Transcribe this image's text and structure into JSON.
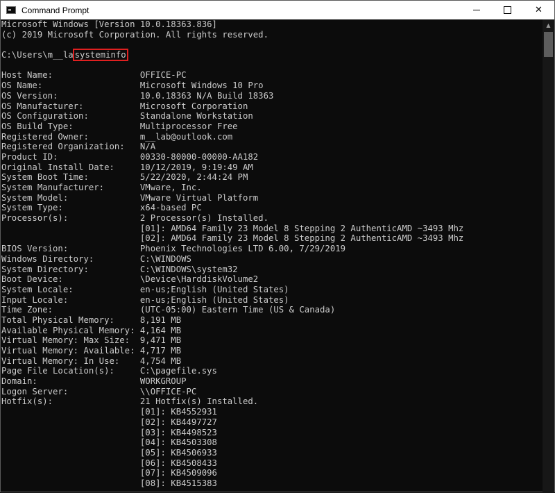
{
  "window": {
    "title": "Command Prompt",
    "controls": {
      "minimize": "",
      "maximize": "",
      "close": "✕"
    }
  },
  "console": {
    "header": [
      "Microsoft Windows [Version 10.0.18363.836]",
      "(c) 2019 Microsoft Corporation. All rights reserved.",
      ""
    ],
    "prompt": "C:\\Users\\m__la",
    "command": "systeminfo",
    "output": [
      "",
      "Host Name:                 OFFICE-PC",
      "OS Name:                   Microsoft Windows 10 Pro",
      "OS Version:                10.0.18363 N/A Build 18363",
      "OS Manufacturer:           Microsoft Corporation",
      "OS Configuration:          Standalone Workstation",
      "OS Build Type:             Multiprocessor Free",
      "Registered Owner:          m__lab@outlook.com",
      "Registered Organization:   N/A",
      "Product ID:                00330-80000-00000-AA182",
      "Original Install Date:     10/12/2019, 9:19:49 AM",
      "System Boot Time:          5/22/2020, 2:44:24 PM",
      "System Manufacturer:       VMware, Inc.",
      "System Model:              VMware Virtual Platform",
      "System Type:               x64-based PC",
      "Processor(s):              2 Processor(s) Installed.",
      "                           [01]: AMD64 Family 23 Model 8 Stepping 2 AuthenticAMD ~3493 Mhz",
      "                           [02]: AMD64 Family 23 Model 8 Stepping 2 AuthenticAMD ~3493 Mhz",
      "BIOS Version:              Phoenix Technologies LTD 6.00, 7/29/2019",
      "Windows Directory:         C:\\WINDOWS",
      "System Directory:          C:\\WINDOWS\\system32",
      "Boot Device:               \\Device\\HarddiskVolume2",
      "System Locale:             en-us;English (United States)",
      "Input Locale:              en-us;English (United States)",
      "Time Zone:                 (UTC-05:00) Eastern Time (US & Canada)",
      "Total Physical Memory:     8,191 MB",
      "Available Physical Memory: 4,164 MB",
      "Virtual Memory: Max Size:  9,471 MB",
      "Virtual Memory: Available: 4,717 MB",
      "Virtual Memory: In Use:    4,754 MB",
      "Page File Location(s):     C:\\pagefile.sys",
      "Domain:                    WORKGROUP",
      "Logon Server:              \\\\OFFICE-PC",
      "Hotfix(s):                 21 Hotfix(s) Installed.",
      "                           [01]: KB4552931",
      "                           [02]: KB4497727",
      "                           [03]: KB4498523",
      "                           [04]: KB4503308",
      "                           [05]: KB4506933",
      "                           [06]: KB4508433",
      "                           [07]: KB4509096",
      "                           [08]: KB4515383"
    ]
  },
  "scrollbar": {
    "up_arrow": "▲"
  },
  "colors": {
    "background": "#0c0c0c",
    "text": "#cccccc",
    "highlight_border": "#e02020"
  }
}
